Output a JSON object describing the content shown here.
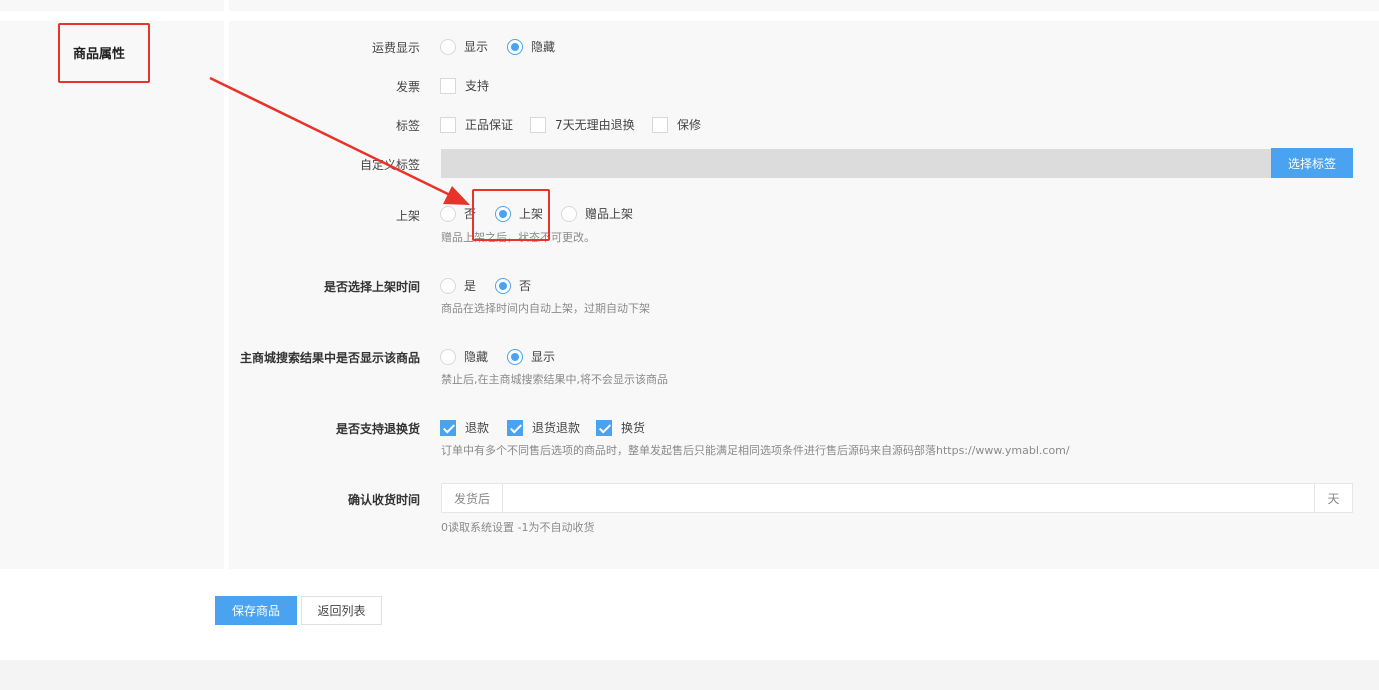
{
  "section": {
    "title": "商品属性"
  },
  "shipping_display": {
    "label": "运费显示",
    "options": [
      {
        "label": "显示",
        "checked": false
      },
      {
        "label": "隐藏",
        "checked": true
      }
    ]
  },
  "invoice": {
    "label": "发票",
    "options": [
      {
        "label": "支持",
        "checked": false
      }
    ]
  },
  "tags": {
    "label": "标签",
    "options": [
      {
        "label": "正品保证",
        "checked": false
      },
      {
        "label": "7天无理由退换",
        "checked": false
      },
      {
        "label": "保修",
        "checked": false
      }
    ]
  },
  "custom_tags": {
    "label": "自定义标签",
    "button": "选择标签"
  },
  "on_shelf": {
    "label": "上架",
    "options": [
      {
        "label": "否",
        "checked": false
      },
      {
        "label": "上架",
        "checked": true
      },
      {
        "label": "赠品上架",
        "checked": false
      }
    ],
    "help": "赠品上架之后，状态不可更改。"
  },
  "schedule": {
    "label": "是否选择上架时间",
    "options": [
      {
        "label": "是",
        "checked": false
      },
      {
        "label": "否",
        "checked": true
      }
    ],
    "help": "商品在选择时间内自动上架，过期自动下架"
  },
  "search_visibility": {
    "label": "主商城搜索结果中是否显示该商品",
    "options": [
      {
        "label": "隐藏",
        "checked": false
      },
      {
        "label": "显示",
        "checked": true
      }
    ],
    "help": "禁止后,在主商城搜索结果中,将不会显示该商品"
  },
  "returns": {
    "label": "是否支持退换货",
    "options": [
      {
        "label": "退款",
        "checked": true
      },
      {
        "label": "退货退款",
        "checked": true
      },
      {
        "label": "换货",
        "checked": true
      }
    ],
    "help": "订单中有多个不同售后选项的商品时，整单发起售后只能满足相同选项条件进行售后源码来自源码部落https://www.ymabl.com/"
  },
  "receipt_time": {
    "label": "确认收货时间",
    "prefix": "发货后",
    "value": "",
    "suffix": "天",
    "help": "0读取系统设置 -1为不自动收货"
  },
  "actions": {
    "save": "保存商品",
    "back": "返回列表"
  },
  "colors": {
    "accent": "#4aa3f0",
    "highlight": "#e8332b"
  }
}
